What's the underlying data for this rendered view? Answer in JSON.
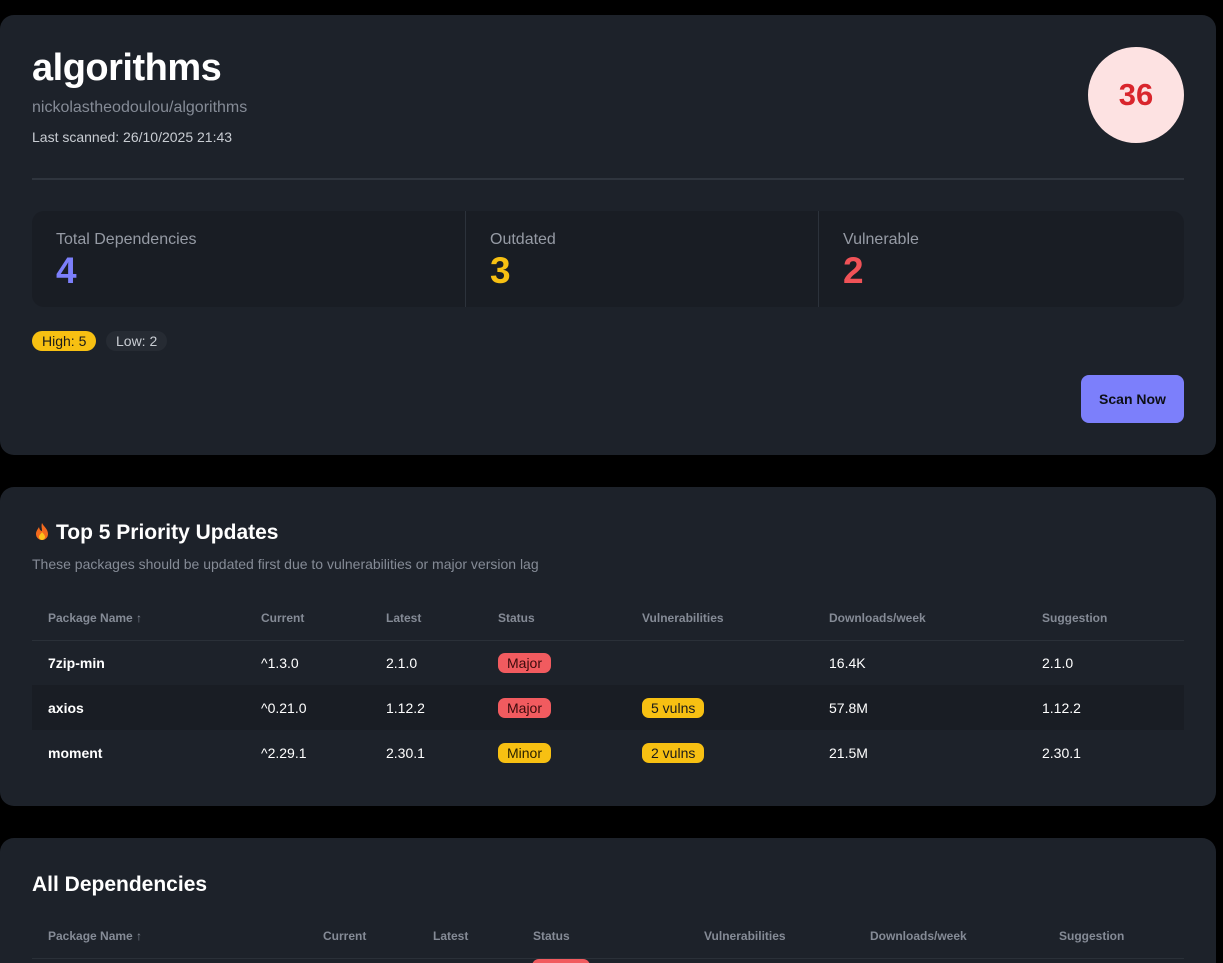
{
  "repo": {
    "name": "algorithms",
    "path": "nickolastheodoulou/algorithms",
    "last_scanned": "Last scanned: 26/10/2025 21:43",
    "score": "36"
  },
  "stats": [
    {
      "label": "Total Dependencies",
      "value": "4",
      "color": "#7c7ffb"
    },
    {
      "label": "Outdated",
      "value": "3",
      "color": "#f7c012"
    },
    {
      "label": "Vulnerable",
      "value": "2",
      "color": "#f05257"
    }
  ],
  "severity": {
    "high": "High: 5",
    "low": "Low: 2"
  },
  "scan_button": "Scan Now",
  "priority": {
    "icon": "fire-icon",
    "title": "Top 5 Priority Updates",
    "subtitle": "These packages should be updated first due to vulnerabilities or major version lag",
    "columns": [
      "Package Name ↑",
      "Current",
      "Latest",
      "Status",
      "Vulnerabilities",
      "Downloads/week",
      "Suggestion"
    ],
    "rows": [
      {
        "name": "7zip-min",
        "current": "^1.3.0",
        "latest": "2.1.0",
        "status": "Major",
        "vulns": "",
        "downloads": "16.4K",
        "suggestion": "2.1.0"
      },
      {
        "name": "axios",
        "current": "^0.21.0",
        "latest": "1.12.2",
        "status": "Major",
        "vulns": "5 vulns",
        "downloads": "57.8M",
        "suggestion": "1.12.2"
      },
      {
        "name": "moment",
        "current": "^2.29.1",
        "latest": "2.30.1",
        "status": "Minor",
        "vulns": "2 vulns",
        "downloads": "21.5M",
        "suggestion": "2.30.1"
      }
    ]
  },
  "all": {
    "title": "All Dependencies",
    "columns": [
      "Package Name ↑",
      "Current",
      "Latest",
      "Status",
      "Vulnerabilities",
      "Downloads/week",
      "Suggestion"
    ]
  }
}
